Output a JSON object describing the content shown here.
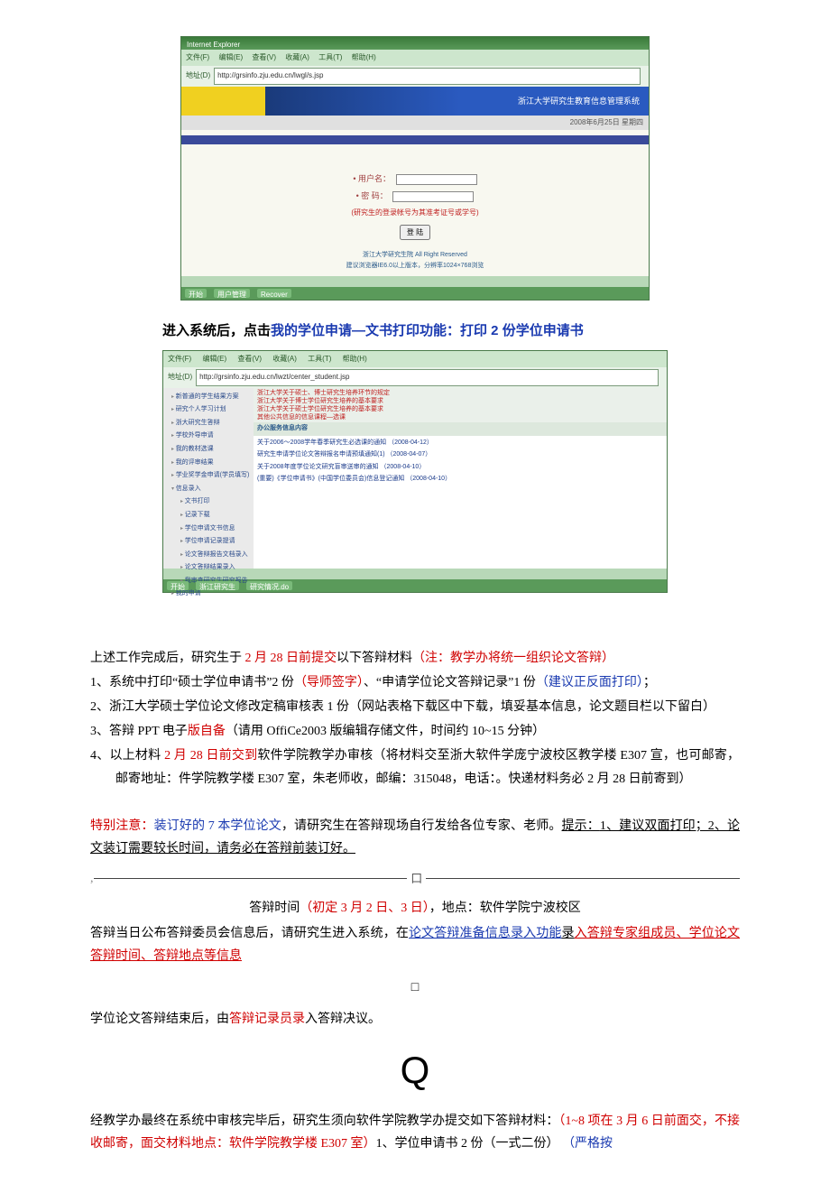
{
  "screenshot1": {
    "title_suffix": "Internet Explorer",
    "menu": [
      "文件(F)",
      "编辑(E)",
      "查看(V)",
      "收藏(A)",
      "工具(T)",
      "帮助(H)"
    ],
    "addr_label": "地址(D)",
    "url": "http://grsinfo.zju.edu.cn/lwgl/s.jsp",
    "banner_text": "浙江大学研究生教育信息管理系统",
    "date_text": "2008年6月25日 星期四",
    "login": {
      "user_label": "• 用户名：",
      "pwd_label": "• 密 码：",
      "hint": "(研究生的登录帐号为其准考证号或学号)",
      "button": "登 陆"
    },
    "footer1": "浙江大学研究生院  All Right Reserved",
    "footer2": "建议浏览器IE6.0以上版本，分辨率1024×768浏览",
    "taskbar": [
      "开始",
      "用户管理",
      "Recover",
      "…"
    ]
  },
  "instr": {
    "prefix": "进入系统后，点击",
    "blue": "我的学位申请—文书打印功能：打印 2 份学位申请书"
  },
  "screenshot2": {
    "menu": [
      "文件(F)",
      "编辑(E)",
      "查看(V)",
      "收藏(A)",
      "工具(T)",
      "帮助(H)"
    ],
    "addr_label": "地址(D)",
    "url": "http://grsinfo.zju.edu.cn/lwzt/center_student.jsp",
    "sidebar": [
      "新普通的学生结果方案",
      "研究个人学习计划",
      "浙大研究生答辩",
      "学校外导申请",
      "我的教材选课",
      "我的评审结果",
      "学业奖学金申请(学员填写)",
      "信息录入"
    ],
    "sidebar_sub": [
      "文书打印",
      "记录下载",
      "学位申请文书信息",
      "学位申请记录提请",
      "论文答辩报告文档录入",
      "论文答辩结果录入",
      "我审查研究生研究报告"
    ],
    "sidebar_bottom": "我的申请",
    "top_red": [
      "浙江大学关于硕士、博士研究生培养环节的规定",
      "浙江大学关于博士学位研究生培养的基本要求",
      "浙江大学关于硕士学位研究生培养的基本要求",
      "其他公共信息的信息课程—选课"
    ],
    "section_hdr": "办公服务信息内容",
    "notices": [
      "关于2006～2008学年春季研究生必选课的通知 （2008-04-12）",
      "研究生申请学位论文答辩报名申请预填通知(1) （2008-04-07）",
      "关于2008年度学位论文研究盲审送审的通知 （2008-04-10）",
      "(重要)《学位申请书》(中国学位委员会)信息登记通知 （2008-04-10）"
    ],
    "taskbar": [
      "开始",
      "浙江研究生",
      "研究情况.do"
    ]
  },
  "body": {
    "line1_a": "上述工作完成后，研究生于",
    "line1_b": " 2 月 28 ",
    "line1_c": "日前提交",
    "line1_d": "以下答辩材料",
    "line1_e": "（注：教学办将统一组织论文答辩）",
    "item1_a": "1、系统中打印“硕士学位申请书”2 份",
    "item1_b": "（导师签字）",
    "item1_c": "、“申请学位论文答辩记录”1 份",
    "item1_d": "（建议正反面打印）",
    "item1_e": "；",
    "item2": "2、浙江大学硕士学位论文修改定稿审核表 1 份（网站表格下载区中下载，填妥基本信息，论文题目栏以下留白）",
    "item3_a": "3、答辩 PPT 电子",
    "item3_b": "版自备",
    "item3_c": "（请用 OffiCe2003 版编辑存储文件，时间约 10~15 分钟）",
    "item4_a": "4、以上材料",
    "item4_b": " 2 月 28 日前交到",
    "item4_c": "软件学院教学办审核（将材料交至浙大软件学庞宁波校区教学楼",
    "item4_d": " E307 ",
    "item4_e": "宣，也可邮寄，邮寄地址：件学院教学楼 E307 室，朱老师收，邮编：315048，电话：。快递材料务必 ",
    "item4_f": "2 ",
    "item4_g": "月 ",
    "item4_h": "28 ",
    "item4_i": "日前寄到）",
    "special_label": "特别注意：",
    "special_a": "装订好的",
    "special_b": " 7 本学位论文",
    "special_c": "，请研究生在答辩现场自行发给各位专家、老师。",
    "special_tip_label": "提示：",
    "special_tip": "1、建议双面打印；2、论文装订需要较长时间，请务必在答辩前装订好。",
    "mid_box": "口",
    "time_a": "答辩时间",
    "time_b": "（初定 3 月 2 日、3 日）",
    "time_c": "，地点：软件学院宁波校区",
    "enter_a": "答辩当日公布答辩委员会信息后，请研究生进入系统，在",
    "enter_b": "论文答辩准备信息录入功能",
    "enter_c": "录",
    "enter_d": "入答辩专家组成员、学位论文答辩时间、答辩地点等信息",
    "box2": "□",
    "defense_a": "学位论文答辩结束后，由",
    "defense_b": "答辩记录员录",
    "defense_c": "入答辩决议。",
    "Q": "Q",
    "final_a": "经教学办最终在系统中审核完毕后，研究生须向软件学院教学办提交如下答辩材料：",
    "final_b": "（1~8 项在 3 月 6 日前面交，不接收邮寄，面交材料地点：软件学院教学楼 E307 室）",
    "final_c": "1、学位申请书 2 份（一式二份）",
    "final_d": "（严格按"
  }
}
